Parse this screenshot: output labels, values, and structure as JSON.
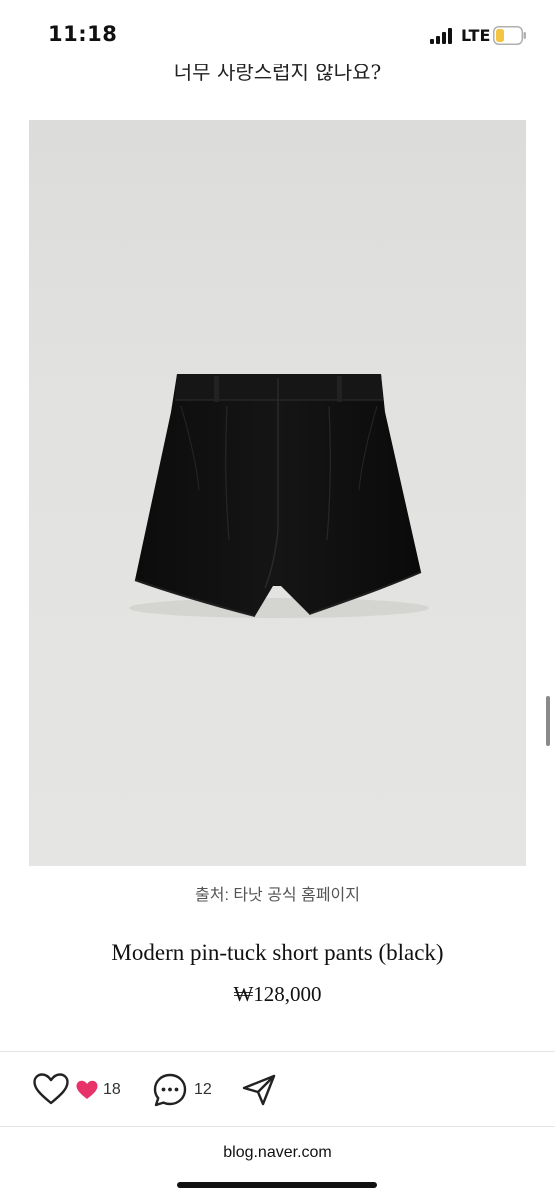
{
  "status_bar": {
    "time": "11:18",
    "network": "LTE",
    "battery_color": "#f4c542"
  },
  "article": {
    "top_caption": "너무 사랑스럽지 않나요?",
    "image_credit": "출처: 타낫 공식 홈페이지",
    "product_name": "Modern pin-tuck short pants (black)",
    "product_price": "₩128,000"
  },
  "actions": {
    "like_count": "18",
    "comment_count": "12",
    "heart_color": "#e8336a"
  },
  "browser": {
    "url": "blog.naver.com"
  },
  "icons": {
    "like": "heart-outline-icon",
    "reaction": "heart-filled-icon",
    "comment": "speech-bubble-icon",
    "share": "paper-plane-icon"
  }
}
